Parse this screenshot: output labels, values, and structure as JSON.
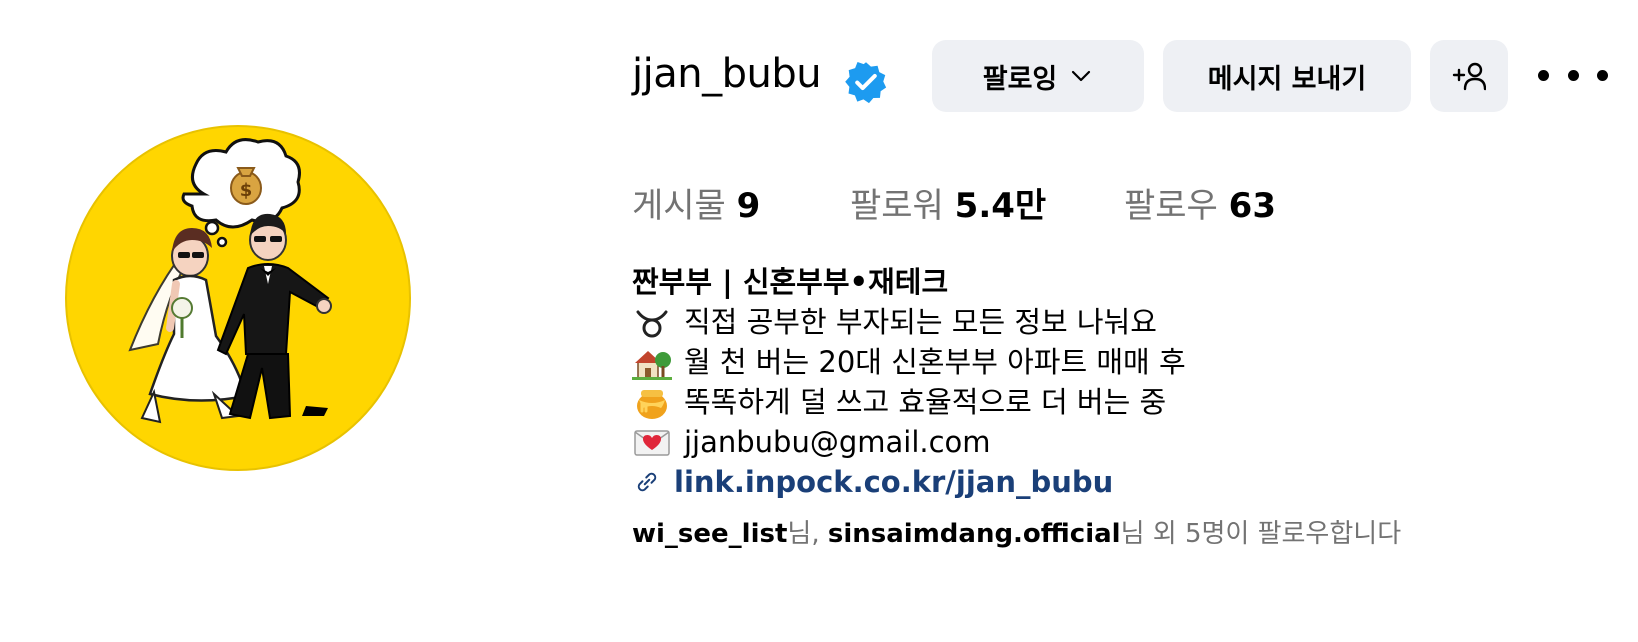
{
  "profile": {
    "username": "jjan_bubu",
    "verified": true,
    "accent_color": "#1d9bf0",
    "avatar_bg": "#ffd600"
  },
  "actions": {
    "following_label": "팔로잉",
    "message_label": "메시지 보내기",
    "add_user_icon": "person-add-icon",
    "more_icon": "more-horizontal-icon"
  },
  "stats": [
    {
      "label": "게시물",
      "value": "9"
    },
    {
      "label": "팔로워",
      "value": "5.4만"
    },
    {
      "label": "팔로우",
      "value": "63"
    }
  ],
  "bio": {
    "name": "짠부부 | 신혼부부•재테크",
    "lines": [
      {
        "icon": "taurus-symbol-icon",
        "text": "직접 공부한 부자되는 모든 정보 나눠요"
      },
      {
        "icon": "house-with-garden-icon",
        "text": "월 천 버는 20대 신혼부부 아파트 매매 후"
      },
      {
        "icon": "honey-pot-icon",
        "text": "똑똑하게 덜 쓰고 효율적으로 더 버는 중"
      },
      {
        "icon": "love-letter-icon",
        "text": "jjanbubu@gmail.com"
      }
    ],
    "link_icon": "link-icon",
    "link": "link.inpock.co.kr/jjan_bubu"
  },
  "followed_by": {
    "account1": "wi_see_list",
    "sep1": "님, ",
    "account2": "sinsaimdang.official",
    "suffix": "님 외 5명이 팔로우합니다"
  }
}
